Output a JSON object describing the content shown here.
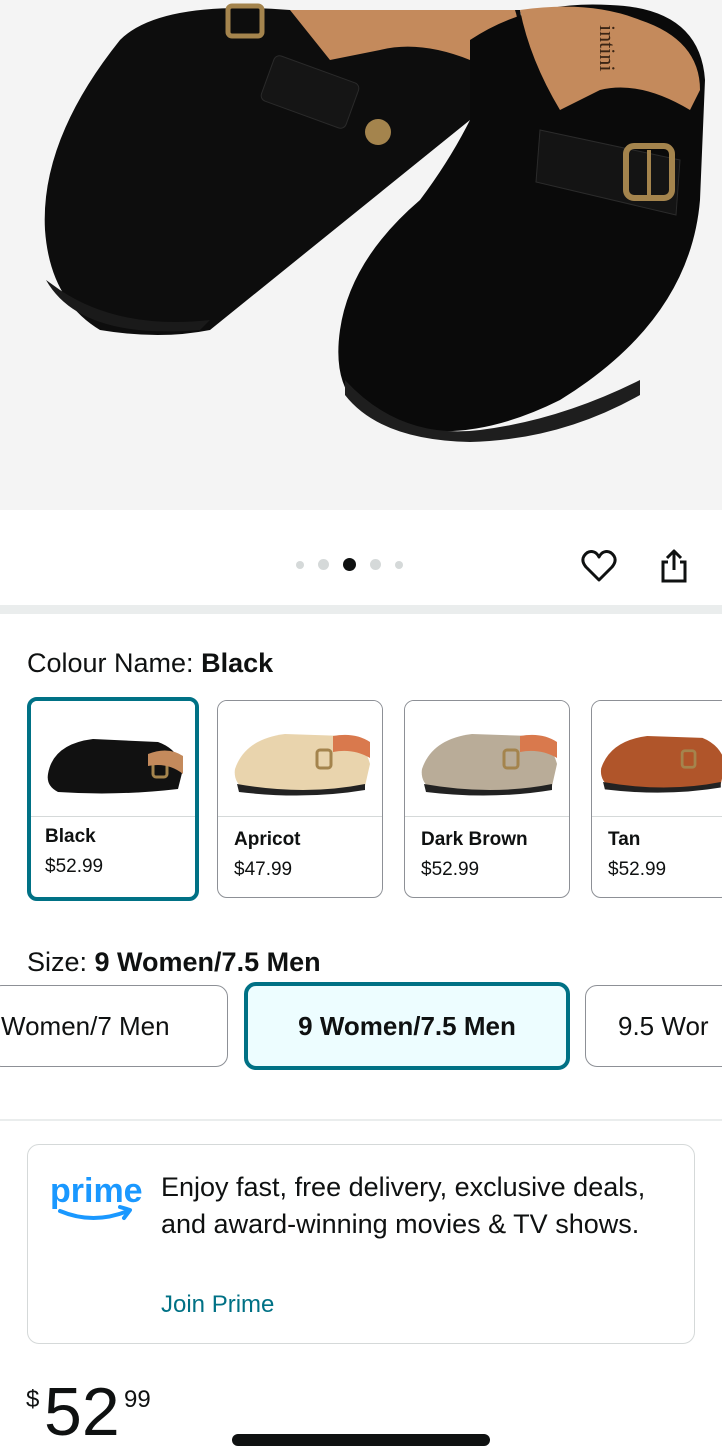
{
  "hero": {
    "brand_mark": "intini",
    "carousel": {
      "count": 5,
      "active_index": 2
    }
  },
  "actions": {
    "wishlist_icon": "heart-icon",
    "share_icon": "share-icon"
  },
  "colour": {
    "label": "Colour Name: ",
    "selected": "Black",
    "options": [
      {
        "name": "Black",
        "price": "$52.99",
        "color": "#111111",
        "selected": true
      },
      {
        "name": "Apricot",
        "price": "$47.99",
        "color": "#e9d4ad",
        "selected": false
      },
      {
        "name": "Dark Brown",
        "price": "$52.99",
        "color": "#b9ac98",
        "selected": false
      },
      {
        "name": "Tan",
        "price": "$52.99",
        "color": "#b0552a",
        "selected": false
      }
    ]
  },
  "size": {
    "label": "Size: ",
    "selected": "9 Women/7.5 Men",
    "options": [
      "Women/7 Men",
      "9 Women/7.5 Men",
      "9.5 Wor"
    ]
  },
  "prime": {
    "logo_text": "prime",
    "message": "Enjoy fast, free delivery, exclusive deals, and award-winning movies & TV shows.",
    "link": "Join Prime"
  },
  "price": {
    "currency": "$",
    "whole": "52",
    "fraction": "99"
  },
  "colors": {
    "accent": "#007185",
    "prime_blue": "#1a98ff",
    "border": "#8d9096"
  }
}
